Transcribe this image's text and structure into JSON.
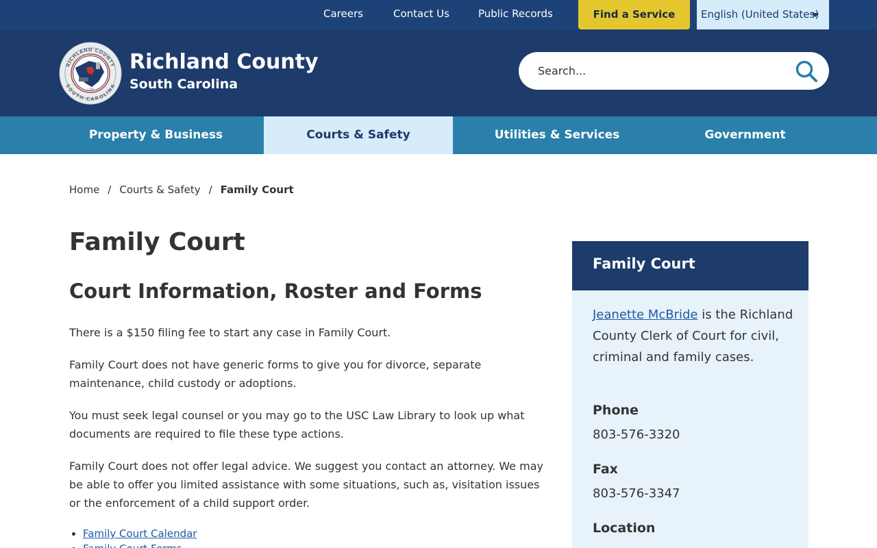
{
  "utility": {
    "links": [
      "Careers",
      "Contact Us",
      "Public Records"
    ],
    "find_service": "Find a Service",
    "language": "English (United States)"
  },
  "header": {
    "title": "Richland County",
    "subtitle": "South Carolina",
    "seal": {
      "top_text": "RICHLAND COUNTY",
      "bottom_text": "SOUTH CAROLINA",
      "year": "1799"
    },
    "search_placeholder": "Search..."
  },
  "nav": {
    "items": [
      "Property & Business",
      "Courts & Safety",
      "Utilities & Services",
      "Government"
    ],
    "active": "Courts & Safety"
  },
  "breadcrumb": {
    "items": [
      "Home",
      "Courts & Safety"
    ],
    "separator": "/",
    "current": "Family Court"
  },
  "main": {
    "title": "Family Court",
    "section_title": "Court Information, Roster and Forms",
    "paragraphs": [
      "There is a $150 filing fee to start any case in Family Court.",
      "Family Court does not have generic forms to give you for divorce, separate maintenance, child custody or adoptions.",
      "You must seek legal counsel or you may go to the USC Law Library to look up what documents are required to file these type actions.",
      "Family Court does not offer legal advice. We suggest you contact an attorney. We may be able to offer you limited assistance with some situations, such as, visitation issues or the enforcement of a child support order."
    ],
    "links": [
      "Family Court Calendar",
      "Family Court Forms"
    ]
  },
  "sidebar": {
    "title": "Family Court",
    "clerk_name": "Jeanette McBride",
    "intro_rest": " is the Richland County Clerk of Court for civil, criminal and family cases.",
    "phone_label": "Phone",
    "phone": "803-576-3320",
    "fax_label": "Fax",
    "fax": "803-576-3347",
    "location_label": "Location"
  },
  "colors": {
    "utility_bg": "#1d4278",
    "header_bg": "#1d3b6b",
    "nav_bg": "#2a80aa",
    "nav_active_bg": "#d6ecfa",
    "find_service_bg": "#e3c72d",
    "sidebar_bg": "#e8f2fa",
    "link": "#1d5aa6"
  }
}
